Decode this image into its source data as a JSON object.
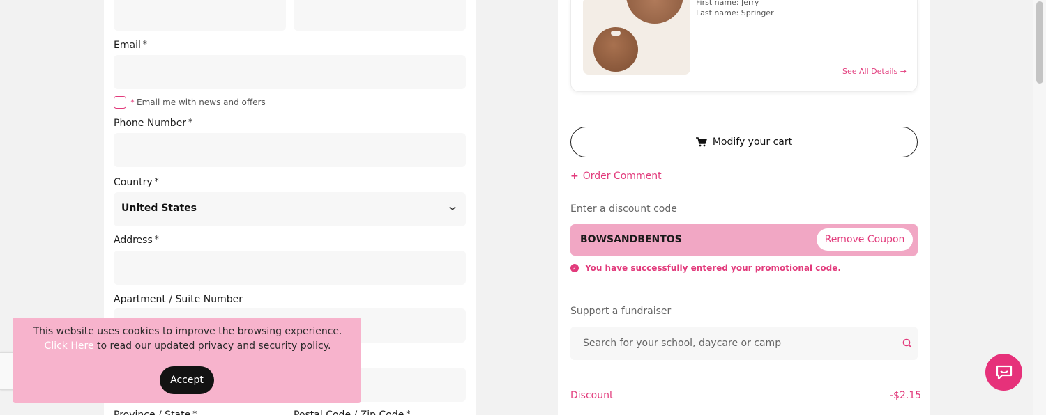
{
  "form": {
    "email_label": "Email",
    "email_value": "",
    "newsletter_label": "Email me with news and offers",
    "phone_label": "Phone Number",
    "phone_value": "",
    "country_label": "Country",
    "country_value": "United States",
    "address_label": "Address",
    "address_value": "",
    "apartment_label": "Apartment / Suite Number",
    "apartment_value": "",
    "province_label": "Province / State",
    "postal_label": "Postal Code / Zip Code",
    "required_marker": "*"
  },
  "cookie": {
    "text_before": "This website uses cookies to improve the browsing experience.",
    "link_text": "Click Here",
    "text_after": "to read our updated privacy and security policy.",
    "accept_label": "Accept"
  },
  "product": {
    "first_name": "First name: Jerry",
    "last_name": "Last name: Springer",
    "see_all": "See All Details →"
  },
  "cart": {
    "modify_label": "Modify your cart",
    "order_comment": "Order Comment",
    "discount_prompt": "Enter a discount code",
    "coupon_code": "BOWSANDBENTOS",
    "remove_coupon": "Remove Coupon",
    "success_message": "You have successfully entered your promotional code.",
    "fundraiser_label": "Support a fundraiser",
    "fundraiser_placeholder": "Search for your school, daycare or camp",
    "discount_label": "Discount",
    "discount_value": "-$2.15"
  },
  "colors": {
    "accent": "#e23b7c",
    "coupon_bg": "#f1a7c4",
    "cookie_bg": "#f7b3cc"
  },
  "icons": [
    "cart-icon",
    "search-icon",
    "chevron-down-icon",
    "check-circle-icon",
    "chat-bubble-icon",
    "arrow-right-icon",
    "plus-icon"
  ]
}
